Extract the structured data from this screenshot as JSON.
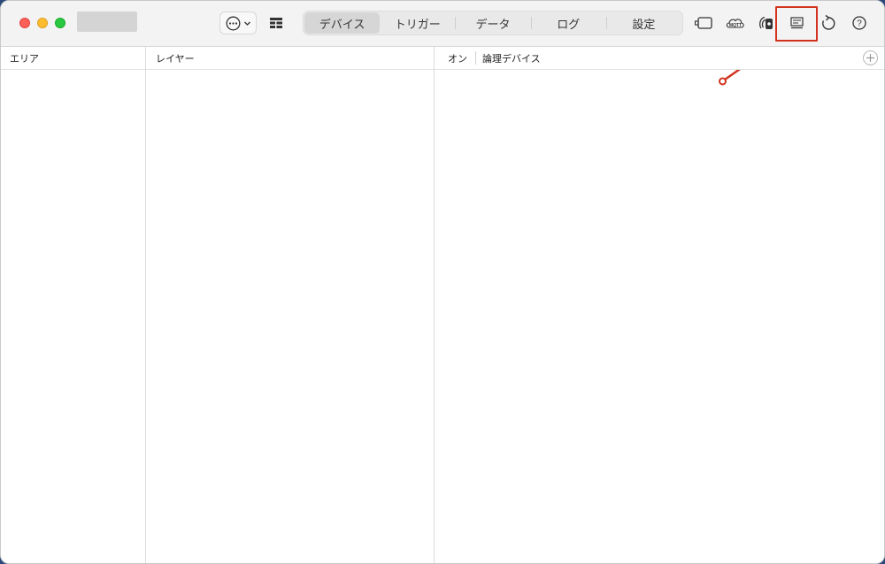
{
  "toolbar": {
    "tabs": [
      {
        "label": "デバイス",
        "active": true
      },
      {
        "label": "トリガー",
        "active": false
      },
      {
        "label": "データ",
        "active": false
      },
      {
        "label": "ログ",
        "active": false
      },
      {
        "label": "設定",
        "active": false
      }
    ],
    "icons": {
      "more": "ellipsis-circle-icon",
      "layout": "table-layout-icon",
      "device_view": "device-window-icon",
      "mqtt": "mqtt-cloud-icon",
      "broadcast": "broadcast-icon",
      "console": "console-icon",
      "refresh": "refresh-icon",
      "help": "help-icon"
    },
    "mqtt_label": "MQTT"
  },
  "columns": {
    "area": "エリア",
    "layer": "レイヤー",
    "on": "オン",
    "logical_device": "論理デバイス"
  },
  "annotation": {
    "color": "#d2331f"
  },
  "colors": {
    "close": "#fe5f57",
    "minimize": "#febc2e",
    "maximize": "#28c840"
  }
}
